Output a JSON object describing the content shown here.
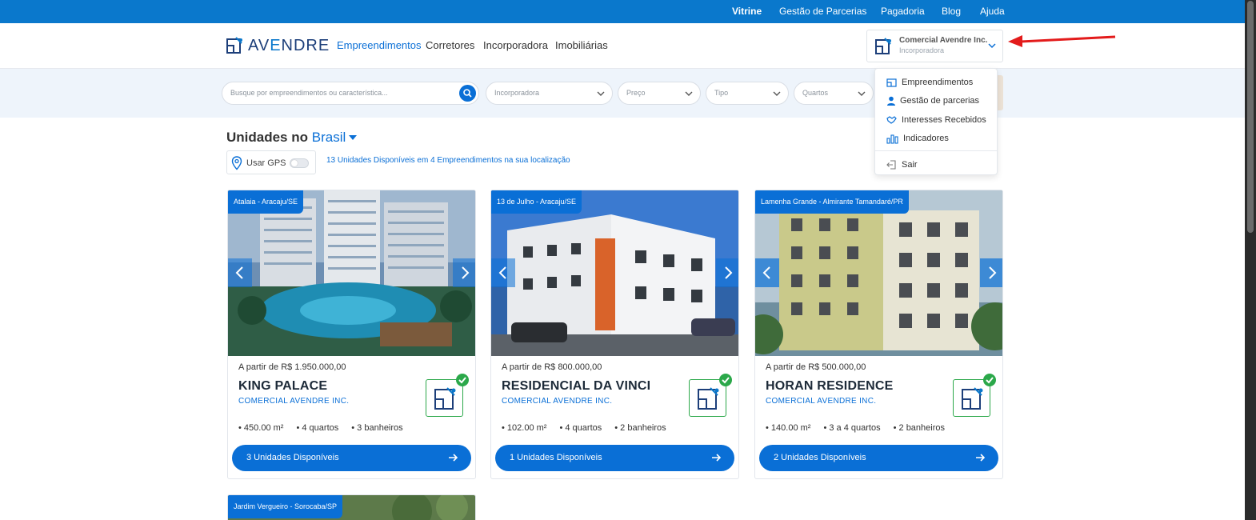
{
  "topbar": {
    "items": [
      "Vitrine",
      "Gestão de Parcerias",
      "Pagadoria",
      "Blog",
      "Ajuda"
    ],
    "active": "Vitrine",
    "color": "#0a78cc"
  },
  "header": {
    "logo_prefix": "AV",
    "logo_e": "E",
    "logo_suffix": "NDRE",
    "nav": [
      "Empreendimentos",
      "Corretores",
      "Incorporadora",
      "Imobiliárias"
    ],
    "active_nav": "Empreendimentos",
    "account": {
      "name": "Comercial Avendre Inc.",
      "role": "Incorporadora"
    }
  },
  "filters": {
    "search_placeholder": "Busque por empreendimentos ou característica...",
    "selects": [
      "Incorporadora",
      "Preço",
      "Tipo",
      "Quartos"
    ]
  },
  "section": {
    "title_prefix": "Unidades no",
    "location": "Brasil",
    "gps_label": "Usar GPS",
    "gps_enabled": false,
    "availability_message": "13 Unidades Disponíveis em 4 Empreendimentos na sua localização"
  },
  "cards": [
    {
      "location": "Atalaia - Aracaju/SE",
      "price": "A partir de R$ 1.950.000,00",
      "name": "KING PALACE",
      "company": "COMERCIAL AVENDRE INC.",
      "area": "450.00 m²",
      "rooms": "4 quartos",
      "baths": "3 banheiros",
      "button": "3 Unidades Disponíveis"
    },
    {
      "location": "13 de Julho - Aracaju/SE",
      "price": "A partir de R$ 800.000,00",
      "name": "RESIDENCIAL DA VINCI",
      "company": "COMERCIAL AVENDRE INC.",
      "area": "102.00 m²",
      "rooms": "4 quartos",
      "baths": "2 banheiros",
      "button": "1 Unidades Disponíveis"
    },
    {
      "location": "Lamenha Grande - Almirante Tamandaré/PR",
      "price": "A partir de R$ 500.000,00",
      "name": "HORAN RESIDENCE",
      "company": "COMERCIAL AVENDRE INC.",
      "area": "140.00 m²",
      "rooms": "3 a 4 quartos",
      "baths": "2 banheiros",
      "button": "2 Unidades Disponíveis"
    },
    {
      "location": "Jardim Vergueiro - Sorocaba/SP"
    }
  ],
  "dropdown": {
    "items": [
      "Empreendimentos",
      "Gestão de parcerias",
      "Interesses Recebidos",
      "Indicadores"
    ],
    "logout": "Sair"
  },
  "colors": {
    "primary": "#0a6fd6",
    "verified": "#2ba84a",
    "annotation": "#e31b1b"
  }
}
